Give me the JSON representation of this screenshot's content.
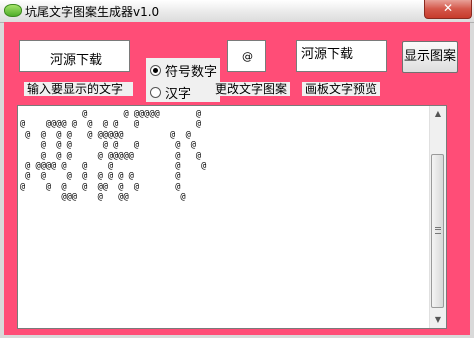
{
  "window": {
    "title": "坑尾文字图案生成器v1.0",
    "close_glyph": "✕",
    "icon": "app-icon"
  },
  "colors": {
    "client_background": "#ff4d77",
    "panel": "#f0f0f0"
  },
  "inputs": {
    "source_text_value": "河源下载",
    "symbol_value": "@",
    "canvas_text_value": "河源下载"
  },
  "mode": {
    "options": [
      "符号数字",
      "汉字"
    ],
    "selected": "符号数字"
  },
  "buttons": {
    "show_pattern": "显示图案"
  },
  "labels": {
    "input_hint": "输入要显示的文字",
    "change_pattern": "更改文字图案",
    "canvas_preview": "画板文字预览"
  },
  "output": {
    "art_lines": [
      "            @       @ @@@@@       @",
      "@    @@@@ @  @  @ @   @           @",
      " @  @  @ @   @ @@@@@         @  @",
      "    @  @ @      @ @   @       @  @",
      "    @  @ @     @ @@@@@        @   @",
      " @ @@@@ @   @    @            @    @",
      " @  @    @  @  @ @ @ @        @",
      "@    @  @   @  @@  @  @       @",
      "        @@@    @   @@          @"
    ],
    "scroll_up": "▲",
    "scroll_down": "▼"
  }
}
